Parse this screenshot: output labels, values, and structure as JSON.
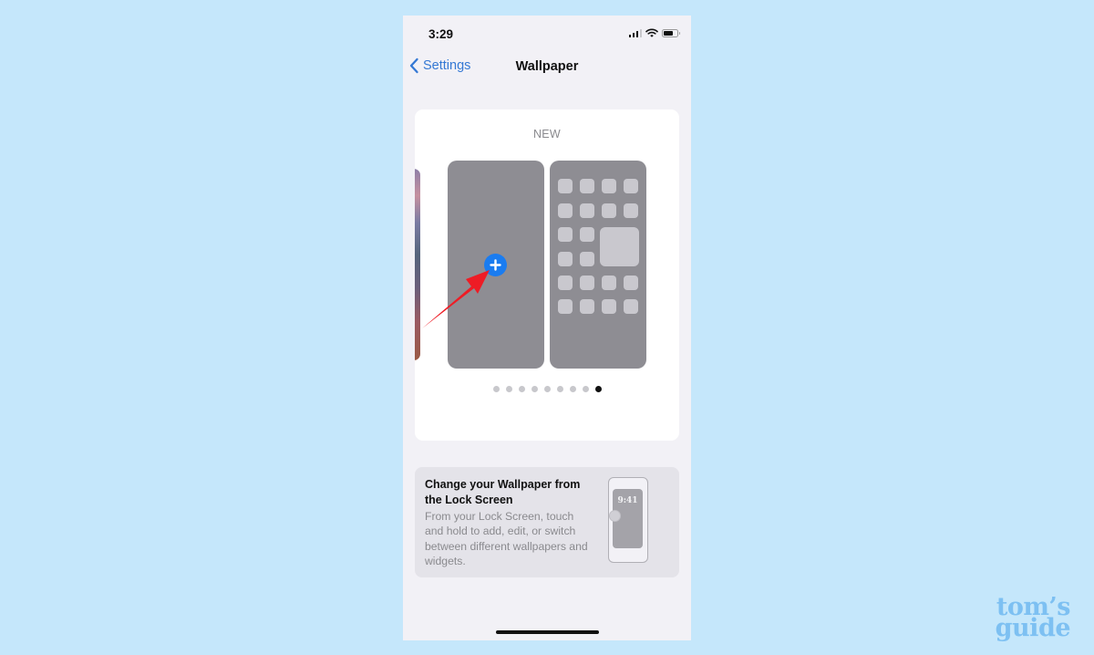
{
  "status_bar": {
    "time": "3:29",
    "signal_bars_active": 3,
    "signal_bars_total": 4,
    "icons": [
      "cellular-signal-icon",
      "wifi-icon",
      "battery-icon"
    ]
  },
  "nav": {
    "back_label": "Settings",
    "title": "Wallpaper"
  },
  "wallpaper_card": {
    "label": "NEW",
    "add_button_icon": "plus-icon",
    "page_count": 9,
    "active_page": 9
  },
  "info_card": {
    "title": "Change your Wallpaper from the Lock Screen",
    "body": "From your Lock Screen, touch and hold to add, edit, or switch between different wallpapers and widgets.",
    "preview_time": "9:41"
  },
  "annotation": {
    "type": "red-arrow",
    "color": "#ee1c25",
    "points_to": "add-wallpaper-button"
  },
  "watermark": {
    "line1": "tom’s",
    "line2": "guide"
  },
  "colors": {
    "page_background": "#c5e7fb",
    "screen_background": "#f2f1f6",
    "accent_blue": "#3478d4",
    "add_button_blue": "#1a7cf0",
    "preview_gray": "#8e8d93"
  }
}
